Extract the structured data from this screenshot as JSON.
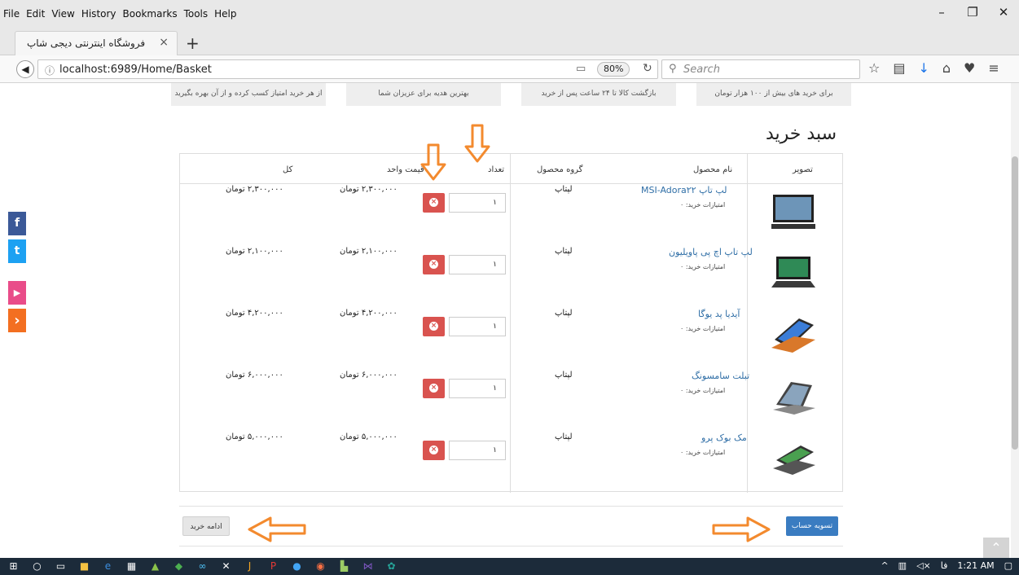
{
  "menubar": {
    "items": [
      "File",
      "Edit",
      "View",
      "History",
      "Bookmarks",
      "Tools",
      "Help"
    ],
    "window_controls": [
      "–",
      "❐",
      "✕"
    ]
  },
  "tab": {
    "title": "فروشگاه اینترنتی دیجی شاپ",
    "close": "×",
    "new_tab": "+"
  },
  "navbar": {
    "url": "localhost:6989/Home/Basket",
    "zoom": "80%",
    "search_placeholder": "Search"
  },
  "features": [
    "از هر خرید امتیاز کسب کرده و از آن بهره بگیرید",
    "بهترین هدیه برای عزیزان شما",
    "بازگشت کالا تا ۲۴ ساعت پس از خرید",
    "برای خرید های بیش از ۱۰۰ هزار تومان"
  ],
  "page": {
    "title": "سبد خرید",
    "headers": {
      "image": "تصویر",
      "name": "نام محصول",
      "group": "گروه محصول",
      "qty": "تعداد",
      "unit_price": "قیمت واحد",
      "total": "کل"
    },
    "rows": [
      {
        "name": "لپ تاپ MSI-Adora۲۲",
        "score": "امتیازات خرید: ۰",
        "group": "لپتاپ",
        "qty": "۱",
        "unit_price": "۲,۳۰۰,۰۰۰ تومان",
        "total": "۲,۳۰۰,۰۰۰ تومان"
      },
      {
        "name": "لپ تاپ اچ پی پاویلیون",
        "score": "امتیازات خرید: ۰",
        "group": "لپتاپ",
        "qty": "۱",
        "unit_price": "۲,۱۰۰,۰۰۰ تومان",
        "total": "۲,۱۰۰,۰۰۰ تومان"
      },
      {
        "name": "آیدیا پد یوگا",
        "score": "امتیازات خرید: ۰",
        "group": "لپتاپ",
        "qty": "۱",
        "unit_price": "۴,۲۰۰,۰۰۰ تومان",
        "total": "۴,۲۰۰,۰۰۰ تومان"
      },
      {
        "name": "تبلت سامسونگ",
        "score": "امتیازات خرید: ۰",
        "group": "لپتاپ",
        "qty": "۱",
        "unit_price": "۶,۰۰۰,۰۰۰ تومان",
        "total": "۶,۰۰۰,۰۰۰ تومان"
      },
      {
        "name": "مک بوک پرو",
        "score": "امتیازات خرید: ۰",
        "group": "لپتاپ",
        "qty": "۱",
        "unit_price": "۵,۰۰۰,۰۰۰ تومان",
        "total": "۵,۰۰۰,۰۰۰ تومان"
      }
    ],
    "checkout": "تسویه حساب",
    "continue": "ادامه خرید"
  },
  "social": [
    {
      "icon": "facebook-icon",
      "glyph": "f",
      "color": "#3b5998"
    },
    {
      "icon": "twitter-icon",
      "glyph": "t",
      "color": "#1da1f2"
    },
    {
      "icon": "play-icon",
      "glyph": "▶",
      "color": "#e94c89"
    },
    {
      "icon": "arrow-icon",
      "glyph": "›",
      "color": "#f36f21"
    }
  ],
  "taskbar": {
    "time": "1:21 AM",
    "lang": "فا"
  }
}
